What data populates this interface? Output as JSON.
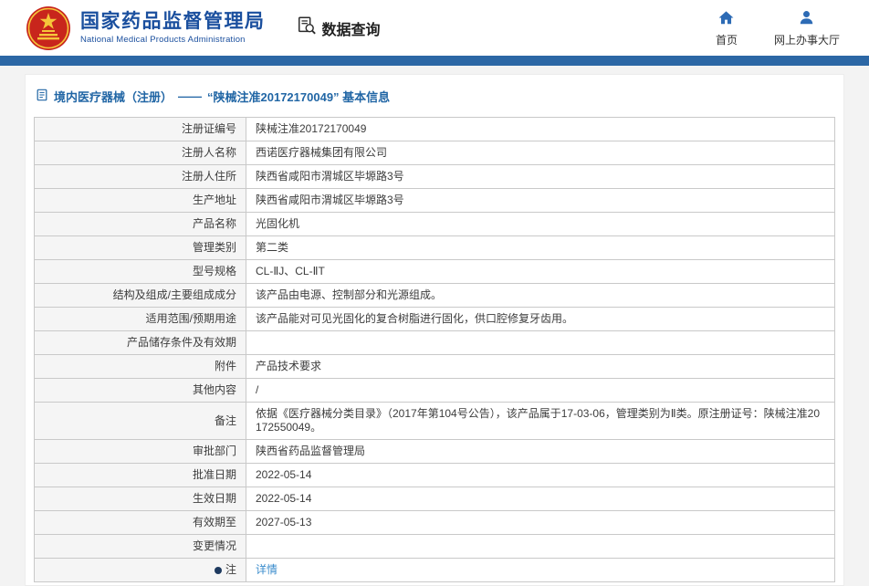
{
  "header": {
    "org_name_cn": "国家药品监督管理局",
    "org_name_en": "National Medical Products Administration",
    "data_query_label": "数据查询",
    "home_label": "首页",
    "service_hall_label": "网上办事大厅"
  },
  "breadcrumb": {
    "section": "境内医疗器械（注册）",
    "separator": "——",
    "title": "“陕械注准20172170049” 基本信息"
  },
  "table": {
    "rows": [
      {
        "label": "注册证编号",
        "value": "陕械注准20172170049"
      },
      {
        "label": "注册人名称",
        "value": "西诺医疗器械集团有限公司"
      },
      {
        "label": "注册人住所",
        "value": "陕西省咸阳市渭城区毕塬路3号"
      },
      {
        "label": "生产地址",
        "value": "陕西省咸阳市渭城区毕塬路3号"
      },
      {
        "label": "产品名称",
        "value": "光固化机"
      },
      {
        "label": "管理类别",
        "value": "第二类"
      },
      {
        "label": "型号规格",
        "value": "CL-ⅡJ、CL-ⅡT"
      },
      {
        "label": "结构及组成/主要组成成分",
        "value": "该产品由电源、控制部分和光源组成。"
      },
      {
        "label": "适用范围/预期用途",
        "value": "该产品能对可见光固化的复合树脂进行固化，供口腔修复牙齿用。"
      },
      {
        "label": "产品储存条件及有效期",
        "value": ""
      },
      {
        "label": "附件",
        "value": "产品技术要求"
      },
      {
        "label": "其他内容",
        "value": "/"
      },
      {
        "label": "备注",
        "value": "依据《医疗器械分类目录》（2017年第104号公告），该产品属于17-03-06，管理类别为Ⅱ类。原注册证号：陕械注准20172550049。"
      },
      {
        "label": "审批部门",
        "value": "陕西省药品监督管理局"
      },
      {
        "label": "批准日期",
        "value": "2022-05-14"
      },
      {
        "label": "生效日期",
        "value": "2022-05-14"
      },
      {
        "label": "有效期至",
        "value": "2027-05-13"
      },
      {
        "label": "变更情况",
        "value": ""
      },
      {
        "label": "注",
        "value": "详情",
        "bullet": true,
        "link": true
      }
    ]
  },
  "colors": {
    "brand_blue": "#1a4f9e",
    "bar_blue": "#2c67a5",
    "breadcrumb_blue": "#2166a5",
    "link_blue": "#3a8ccc",
    "emblem_red": "#c8251c",
    "emblem_gold": "#f5c53a"
  }
}
